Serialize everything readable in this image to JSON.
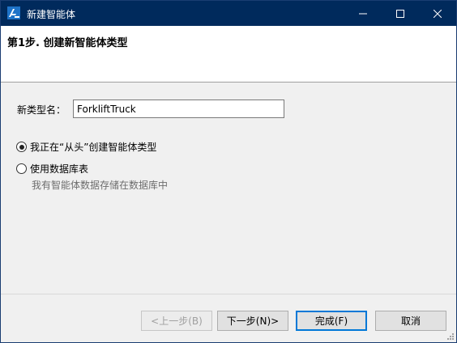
{
  "window": {
    "title": "新建智能体",
    "app_icon": "anylogic-logo-icon",
    "controls": {
      "minimize": "minimize-icon",
      "maximize": "maximize-icon",
      "close": "close-icon"
    }
  },
  "header": {
    "step_title": "第1步. 创建新智能体类型"
  },
  "form": {
    "name_label": "新类型名：",
    "name_value": "ForkliftTruck"
  },
  "options": [
    {
      "label": "我正在“从头”创建智能体类型",
      "checked": true
    },
    {
      "label": "使用数据库表",
      "checked": false,
      "hint": "我有智能体数据存储在数据库中"
    }
  ],
  "buttons": {
    "back": "<上一步(B)",
    "next": "下一步(N)>",
    "finish": "完成(F)",
    "cancel": "取消"
  },
  "colors": {
    "titlebar": "#002a5c",
    "default_button_border": "#0078d7"
  }
}
